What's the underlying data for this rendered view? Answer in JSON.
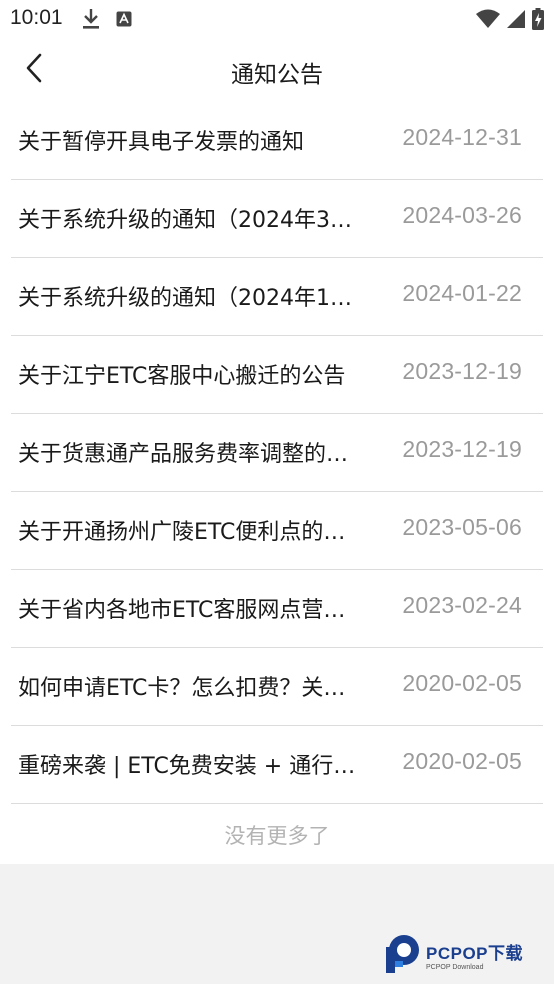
{
  "status_bar": {
    "time": "10:01"
  },
  "header": {
    "title": "通知公告"
  },
  "notices": [
    {
      "title": "关于暂停开具电子发票的通知",
      "date": "2024-12-31"
    },
    {
      "title": "关于系统升级的通知（2024年3…",
      "date": "2024-03-26"
    },
    {
      "title": "关于系统升级的通知（2024年1…",
      "date": "2024-01-22"
    },
    {
      "title": "关于江宁ETC客服中心搬迁的公告",
      "date": "2023-12-19"
    },
    {
      "title": "关于货惠通产品服务费率调整的…",
      "date": "2023-12-19"
    },
    {
      "title": "关于开通扬州广陵ETC便利点的…",
      "date": "2023-05-06"
    },
    {
      "title": "关于省内各地市ETC客服网点营…",
      "date": "2023-02-24"
    },
    {
      "title": "如何申请ETC卡？怎么扣费？关…",
      "date": "2020-02-05"
    },
    {
      "title": "重磅来袭 | ETC免费安装 + 通行…",
      "date": "2020-02-05"
    }
  ],
  "footer": {
    "no_more": "没有更多了"
  },
  "watermark": {
    "name": "PCPOP下载",
    "sub": "PCPOP Download"
  },
  "colors": {
    "date_text": "#9a9a9a",
    "divider": "#dcdcdc",
    "background": "#f2f2f2",
    "watermark": "#1b3f8f"
  }
}
